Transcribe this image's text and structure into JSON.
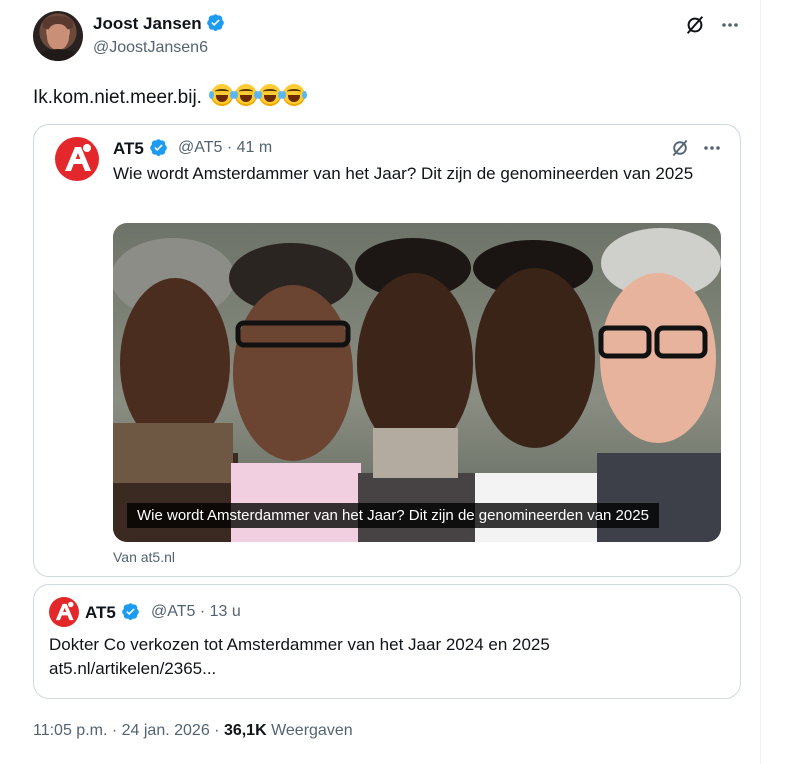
{
  "author": {
    "name": "Joost Jansen",
    "handle": "@JoostJansen6",
    "verified": true
  },
  "tweet": {
    "text": "Ik.kom.niet.meer.bij.",
    "emoji": [
      "face-with-tears-of-joy",
      "face-with-tears-of-joy",
      "face-with-tears-of-joy",
      "face-with-tears-of-joy"
    ]
  },
  "icons": {
    "grok": "grok-icon",
    "more": "more-icon",
    "verified": "verified-badge-icon"
  },
  "quote": {
    "name": "AT5",
    "meta": "@AT5 · 41 m",
    "text": "Wie wordt Amsterdammer van het Jaar? Dit zijn de genomineerden van 2025",
    "image_caption": "Wie wordt Amsterdammer van het Jaar? Dit zijn de genomineerden van 2025",
    "source": "Van at5.nl"
  },
  "card2": {
    "name": "AT5",
    "meta": "@AT5 · 13 u",
    "line1": "Dokter Co verkozen tot Amsterdammer van het Jaar 2024 en 2025",
    "line2": "at5.nl/artikelen/2365..."
  },
  "footer": {
    "time": "11:05 p.m. · 24 jan. 2026 · ",
    "views": "36,1K",
    "views_label": "Weergaven"
  },
  "colors": {
    "accent": "#1d9bf0",
    "brand_at5": "#e3272b",
    "secondary_text": "#536471",
    "border": "#cfd9de"
  }
}
